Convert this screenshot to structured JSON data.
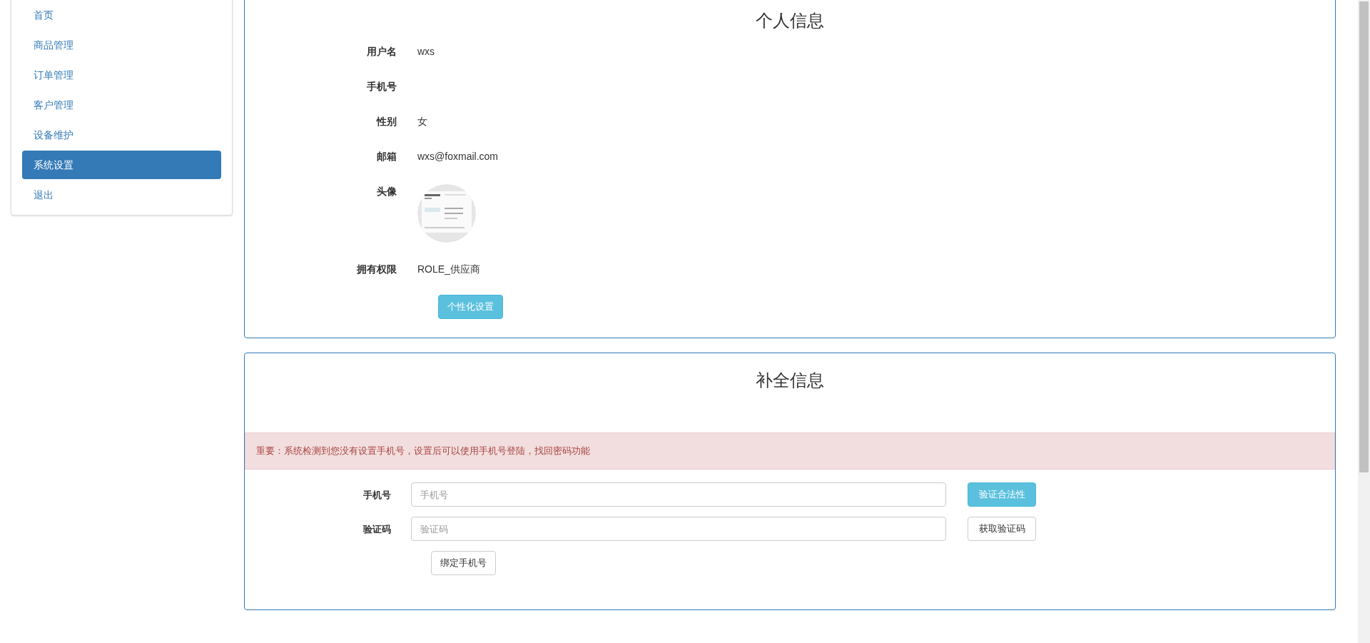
{
  "sidebar": {
    "items": [
      {
        "label": "首页",
        "selected": false
      },
      {
        "label": "商品管理",
        "selected": false
      },
      {
        "label": "订单管理",
        "selected": false
      },
      {
        "label": "客户管理",
        "selected": false
      },
      {
        "label": "设备维护",
        "selected": false
      },
      {
        "label": "系统设置",
        "selected": true
      },
      {
        "label": "退出",
        "selected": false
      }
    ]
  },
  "profile": {
    "title": "个人信息",
    "rows": [
      {
        "kind": "text",
        "label": "用户名",
        "value": "wxs"
      },
      {
        "kind": "text",
        "label": "手机号"
      },
      {
        "kind": "text",
        "label": "性别",
        "value": "女"
      },
      {
        "kind": "text",
        "label": "邮箱",
        "value": "wxs@foxmail.com"
      },
      {
        "kind": "picture",
        "label": "头像"
      },
      {
        "kind": "text",
        "label": "拥有权限",
        "value": "ROLE_供应商"
      }
    ],
    "button": "个性化设置"
  },
  "complete": {
    "title": "补全信息",
    "alert": "重要：系统检测到您没有设置手机号，设置后可以使用手机号登陆，找回密码功能",
    "fields": [
      {
        "label": "手机号",
        "placeholder": "手机号",
        "button": "验证合法性",
        "kind": "info"
      },
      {
        "label": "验证码",
        "placeholder": "验证码",
        "button": "获取验证码",
        "kind": "default"
      }
    ],
    "submit": "绑定手机号"
  }
}
